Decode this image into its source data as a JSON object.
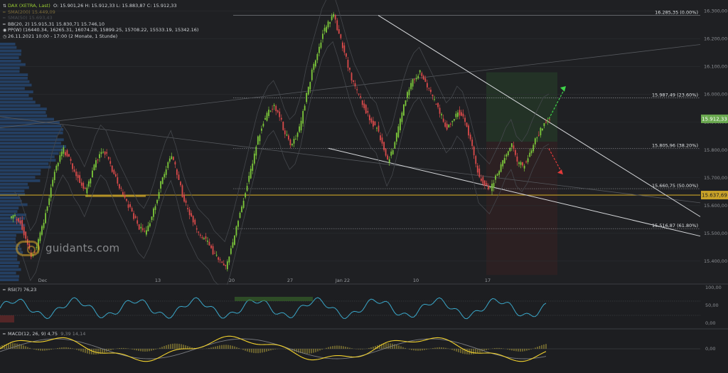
{
  "header": {
    "line1_symbol": "DAX (XETRA, Last)",
    "line1_ohlc": "O: 15.901,26  H: 15.912,33  L: 15.883,87  C: 15.912,33",
    "line2": "SMA(200) 15.449,09",
    "line3": "SMA(50) 15.693,43",
    "line4": "BB(20, 2)  15.915,31  15.830,71  15.746,10",
    "line5": "PP(W)  (16440.34, 16265.31, 16074.28, 15899.25, 15708.22, 15533.19, 15342.16)",
    "line6": "26.11.2021 10:00 - 17:00  (2 Monate, 1 Stunde)"
  },
  "logo_text": "guidants.com",
  "price_axis": {
    "labels": [
      "16.300,00",
      "16.200,00",
      "16.100,00",
      "16.000,00",
      "15.900,00",
      "15.800,00",
      "15.700,00",
      "15.600,00",
      "15.500,00",
      "15.400,00"
    ],
    "current_price": "15.912,33",
    "current_color": "#6aa84f",
    "level_price": "15.637,69",
    "level_color": "#c9a227"
  },
  "time_axis": [
    "Dec",
    "13",
    "20",
    "27",
    "Jan 22",
    "10",
    "17"
  ],
  "fib_levels": [
    {
      "price": 16285.35,
      "label": "16.285,35 (0.00%)"
    },
    {
      "price": 15987.49,
      "label": "15.987,49 (23.60%)"
    },
    {
      "price": 15805.96,
      "label": "15.805,96 (38.20%)"
    },
    {
      "price": 15660.75,
      "label": "15.660,75 (50.00%)"
    },
    {
      "price": 15516.87,
      "label": "15.516,87 (61.80%)"
    }
  ],
  "rsi": {
    "title": "RSI(7)  76,23",
    "labels": [
      "100,00",
      "50,00",
      "0,00"
    ]
  },
  "macd": {
    "title": "MACD(12, 26, 9)  4,75",
    "extra": "9,39  14,14",
    "labels": [
      "0,00"
    ]
  },
  "chart_data": {
    "type": "candlestick",
    "title": "DAX (XETRA, Last)",
    "y_range": [
      15320,
      16330
    ],
    "price_series_approx": [
      15560,
      15540,
      15480,
      15420,
      15450,
      15520,
      15600,
      15700,
      15760,
      15800,
      15770,
      15720,
      15690,
      15650,
      15700,
      15760,
      15800,
      15780,
      15730,
      15680,
      15640,
      15600,
      15560,
      15520,
      15500,
      15540,
      15600,
      15680,
      15740,
      15780,
      15720,
      15640,
      15580,
      15540,
      15500,
      15480,
      15460,
      15420,
      15400,
      15380,
      15440,
      15520,
      15600,
      15680,
      15760,
      15840,
      15900,
      15940,
      15960,
      15920,
      15860,
      15820,
      15840,
      15900,
      16000,
      16080,
      16150,
      16220,
      16260,
      16280,
      16220,
      16150,
      16080,
      16020,
      15980,
      15940,
      15900,
      15880,
      15820,
      15760,
      15800,
      15880,
      15960,
      16020,
      16060,
      16080,
      16040,
      16000,
      15960,
      15920,
      15880,
      15900,
      15940,
      15920,
      15860,
      15780,
      15700,
      15680,
      15660,
      15700,
      15740,
      15790,
      15820,
      15760,
      15740,
      15770,
      15820,
      15860,
      15900,
      15912
    ],
    "channel_upper": {
      "from_price": 16285.35,
      "to_price": 15560
    },
    "channel_lower": {
      "from_price": 15805.96,
      "to_price": 15490
    },
    "sma200_level": 15449.09,
    "horizontal_level": 15637.69
  }
}
